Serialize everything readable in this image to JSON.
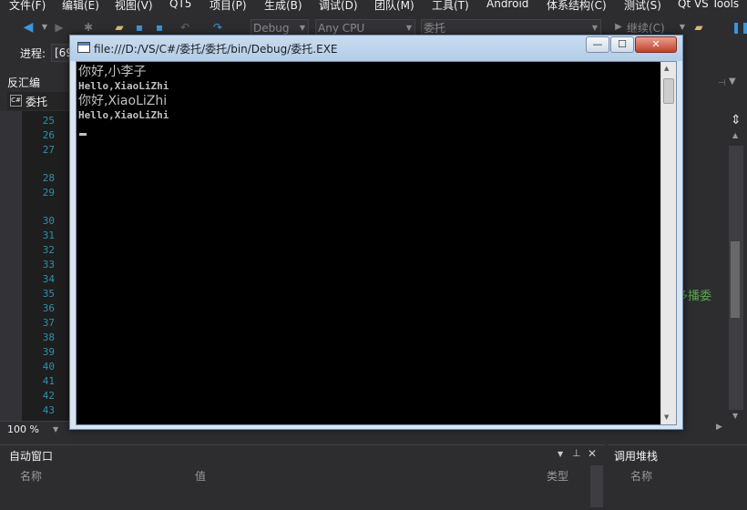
{
  "menubar": {
    "items": [
      "文件(F)",
      "编辑(E)",
      "视图(V)",
      "QT5",
      "项目(P)",
      "生成(B)",
      "调试(D)",
      "团队(M)",
      "工具(T)",
      "Android",
      "体系结构(C)",
      "测试(S)",
      "Qt VS Tools"
    ]
  },
  "toolbar": {
    "config": "Debug",
    "platform": "Any CPU",
    "project": "委托",
    "continue_label": "继续(C)"
  },
  "procrow": {
    "label": "进程:",
    "value": "[69"
  },
  "left_panel": {
    "tab_label": "反汇编",
    "doc_label": "委托",
    "doc_icon": "C#",
    "line_numbers": [
      "25",
      "26",
      "27",
      "28",
      "29",
      "30",
      "31",
      "32",
      "33",
      "34",
      "35",
      "36",
      "37",
      "38",
      "39",
      "40",
      "41",
      "42",
      "43"
    ],
    "zoom": "100 %"
  },
  "right_snippet": "多播委",
  "console": {
    "title": "file:///D:/VS/C#/委托/委托/bin/Debug/委托.EXE",
    "lines": [
      "你好,小李子",
      "Hello,XiaoLiZhi",
      "你好,XiaoLiZhi",
      "Hello,XiaoLiZhi"
    ]
  },
  "bottom": {
    "autos_title": "自动窗口",
    "autos_cols": [
      "名称",
      "值",
      "类型"
    ],
    "callstack_title": "调用堆栈",
    "callstack_cols": [
      "名称"
    ]
  },
  "colors": {
    "vs_bg": "#2d2d30",
    "console_bg": "#000000",
    "console_text": "#c0c0c0",
    "line_number": "#2b91af",
    "comment_green": "#57a64a"
  }
}
